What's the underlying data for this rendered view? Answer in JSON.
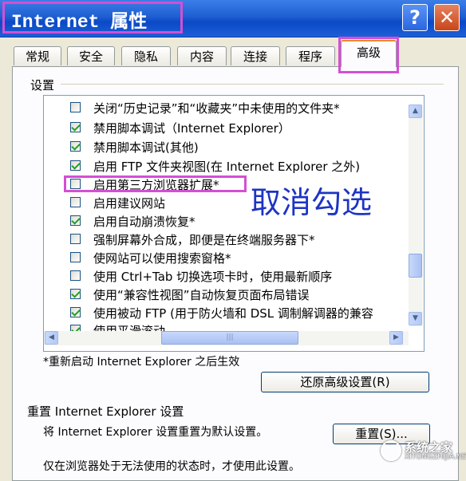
{
  "window": {
    "title": "Internet 属性",
    "help_label": "?",
    "close_label": "✕"
  },
  "tabs": [
    {
      "label": "常规",
      "active": false
    },
    {
      "label": "安全",
      "active": false
    },
    {
      "label": "隐私",
      "active": false
    },
    {
      "label": "内容",
      "active": false
    },
    {
      "label": "连接",
      "active": false
    },
    {
      "label": "程序",
      "active": false
    },
    {
      "label": "高级",
      "active": true
    }
  ],
  "settings": {
    "group_label": "设置",
    "items": [
      {
        "label": "关闭“历史记录”和“收藏夹”中未使用的文件夹*",
        "checked": false
      },
      {
        "label": "禁用脚本调试（Internet Explorer）",
        "checked": true
      },
      {
        "label": "禁用脚本调试(其他)",
        "checked": true
      },
      {
        "label": "启用 FTP 文件夹视图(在 Internet Explorer 之外)",
        "checked": true
      },
      {
        "label": "启用第三方浏览器扩展*",
        "checked": false
      },
      {
        "label": "启用建议网站",
        "checked": false
      },
      {
        "label": "启用自动崩溃恢复*",
        "checked": true
      },
      {
        "label": "强制屏幕外合成，即便是在终端服务器下*",
        "checked": false
      },
      {
        "label": "使网站可以使用搜索窗格*",
        "checked": false
      },
      {
        "label": "使用 Ctrl+Tab 切换选项卡时，使用最新顺序",
        "checked": false
      },
      {
        "label": "使用“兼容性视图”自动恢复页面布局错误",
        "checked": true
      },
      {
        "label": "使用被动 FTP (用于防火墙和 DSL 调制解调器的兼容",
        "checked": true
      },
      {
        "label": "使用平滑滚动",
        "checked": true
      }
    ],
    "scroll_position": 0.72
  },
  "annotation": {
    "text": "取消勾选",
    "color": "#1d34c3",
    "highlight_color": "#d44fd3"
  },
  "restart_note": "*重新启动 Internet Explorer 之后生效",
  "restore_button": "还原高级设置(R)",
  "reset": {
    "section_title": "重置 Internet Explorer 设置",
    "description": "将 Internet Explorer 设置重置为默认设置。",
    "button": "重置(S)...",
    "bottom_note": "仅在浏览器处于无法使用的状态时，才使用此设置。"
  },
  "watermark": {
    "line1": "系统之家",
    "line2": "XITONGZHIJIA.NET"
  },
  "icons": {
    "scroll_up": "triangle-up-icon",
    "scroll_down": "triangle-down-icon",
    "scroll_left": "triangle-left-icon",
    "scroll_right": "triangle-right-icon"
  }
}
